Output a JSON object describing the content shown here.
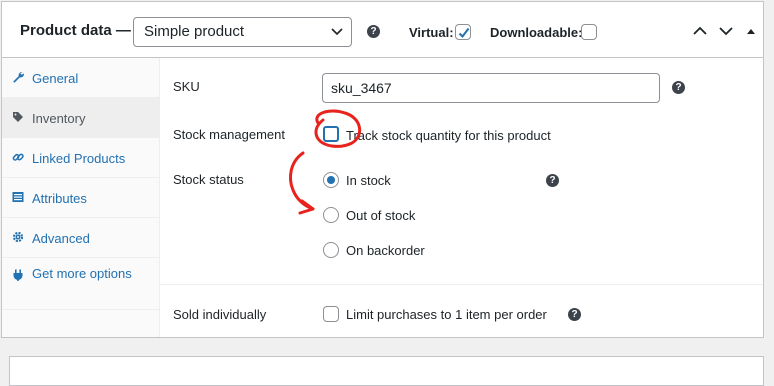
{
  "header": {
    "title": "Product data —",
    "product_type": "Simple product",
    "virtual_label": "Virtual:",
    "virtual_checked": true,
    "downloadable_label": "Downloadable:",
    "downloadable_checked": false,
    "help_icon": "?"
  },
  "tabs": [
    {
      "label": "General",
      "icon": "wrench-icon",
      "active": false
    },
    {
      "label": "Inventory",
      "icon": "tag-icon",
      "active": true
    },
    {
      "label": "Linked Products",
      "icon": "link-icon",
      "active": false
    },
    {
      "label": "Attributes",
      "icon": "list-icon",
      "active": false
    },
    {
      "label": "Advanced",
      "icon": "gear-icon",
      "active": false
    },
    {
      "label": "Get more options",
      "icon": "plugin-icon",
      "active": false
    }
  ],
  "inventory": {
    "sku_label": "SKU",
    "sku_value": "sku_3467",
    "stock_management_label": "Stock management",
    "stock_management_desc": "Track stock quantity for this product",
    "stock_status_label": "Stock status",
    "stock_options": [
      {
        "label": "In stock",
        "checked": true
      },
      {
        "label": "Out of stock",
        "checked": false
      },
      {
        "label": "On backorder",
        "checked": false
      }
    ],
    "sold_individually_label": "Sold individually",
    "sold_individually_desc": "Limit purchases to 1 item per order"
  },
  "colors": {
    "accent": "#2271b1",
    "annotation": "#e8231e"
  }
}
